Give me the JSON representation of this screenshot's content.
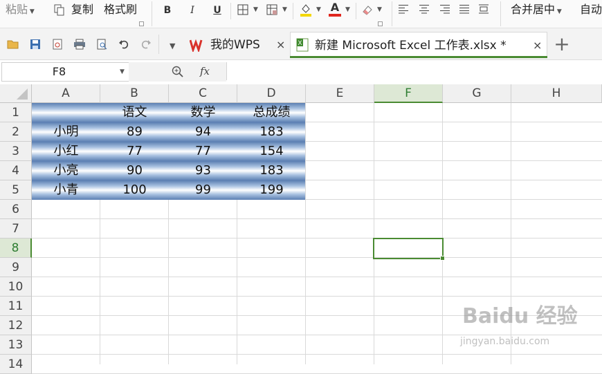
{
  "toolbar": {
    "paste": "粘贴",
    "copy": "复制",
    "format_painter": "格式刷",
    "bold": "B",
    "italic": "I",
    "underline": "U",
    "font_color_letter": "A",
    "merge_center": "合并居中",
    "auto_wrap": "自动"
  },
  "tabs": [
    {
      "label": "我的WPS",
      "close": "×"
    },
    {
      "label": "新建 Microsoft Excel 工作表.xlsx *",
      "close": "×"
    }
  ],
  "new_tab": "+",
  "formula_bar": {
    "name_box": "F8",
    "fx": "fx",
    "formula": ""
  },
  "columns": [
    "A",
    "B",
    "C",
    "D",
    "E",
    "F",
    "G",
    "H"
  ],
  "rows": [
    "1",
    "2",
    "3",
    "4",
    "5",
    "6",
    "7",
    "8",
    "9",
    "10",
    "11",
    "12",
    "13",
    "14"
  ],
  "selected_cell": "F8",
  "table": {
    "header": [
      "",
      "语文",
      "数学",
      "总成绩"
    ],
    "data": [
      [
        "小明",
        "89",
        "94",
        "183"
      ],
      [
        "小红",
        "77",
        "77",
        "154"
      ],
      [
        "小亮",
        "90",
        "93",
        "183"
      ],
      [
        "小青",
        "100",
        "99",
        "199"
      ]
    ]
  },
  "watermark": {
    "main": "Baidu 经验",
    "sub": "jingyan.baidu.com"
  },
  "colors": {
    "accent_green": "#4a8b32",
    "band_dark": "#5b7fb2",
    "band_light": "#a7c0e0"
  }
}
